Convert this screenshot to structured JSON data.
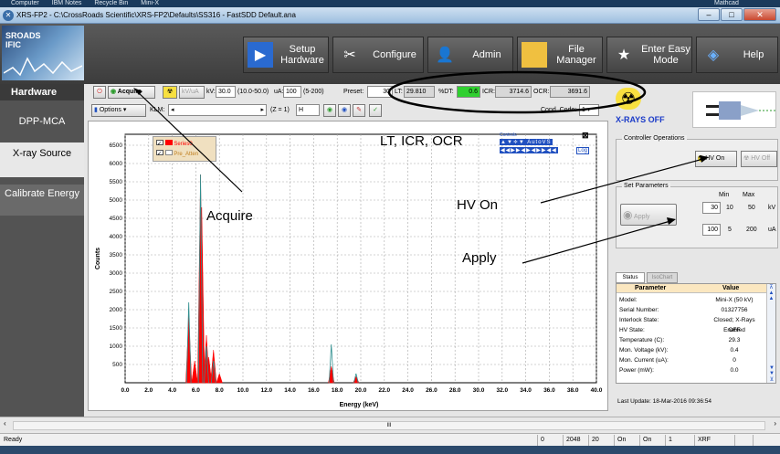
{
  "desktop": {
    "items": [
      "Computer",
      "IBM Notes",
      "Recycle Bin",
      "Mini-X",
      "Mathcad"
    ]
  },
  "window": {
    "title": "XRS-FP2 - C:\\CrossRoads Scientific\\XRS-FP2\\Defaults\\SS316 - FastSDD Default.ana"
  },
  "toolbar": {
    "logo_line1": "SROADS",
    "logo_line2": "IFIC",
    "setup": "Setup Hardware",
    "configure": "Configure",
    "admin": "Admin",
    "file": "File Manager",
    "easy": "Enter Easy Mode",
    "help": "Help"
  },
  "nav": {
    "hardware": "Hardware",
    "dpp": "DPP-MCA",
    "xray": "X-ray Source",
    "calibrate": "Calibrate Energy"
  },
  "controls": {
    "acquire": "Acquire",
    "kv_ua": "kV/uA",
    "kv_label": "kV:",
    "kv_value": "30.0",
    "kv_range": "(10.0-50.0)",
    "ua_label": "uA:",
    "ua_value": "100",
    "ua_range": "(5-200)",
    "preset_label": "Preset:",
    "preset_value": "30",
    "lt_label": "LT:",
    "lt_value": "29.810",
    "dt_label": "%DT:",
    "dt_value": "0.6",
    "icr_label": "ICR:",
    "icr_value": "3714.6",
    "ocr_label": "OCR:",
    "ocr_value": "3691.6",
    "options": "Options",
    "klm_label": "KLM:",
    "z_label": "(Z = 1)",
    "z_value": "H",
    "cond_label": "Cond. Code:",
    "cond_value": "1"
  },
  "legend": {
    "series0": "Series0",
    "preatten": "Pre_Atten"
  },
  "ctrl_panel": {
    "title": "Controls",
    "autovs": "AutoVS",
    "log": "Log"
  },
  "chart_data": {
    "type": "line",
    "xlabel": "Energy (keV)",
    "ylabel": "Counts",
    "xlim": [
      0,
      40
    ],
    "ylim": [
      0,
      6800
    ],
    "xticks": [
      "0.0",
      "2.0",
      "4.0",
      "6.0",
      "8.0",
      "10.0",
      "12.0",
      "14.0",
      "16.0",
      "18.0",
      "20.0",
      "22.0",
      "24.0",
      "26.0",
      "28.0",
      "30.0",
      "32.0",
      "34.0",
      "36.0",
      "38.0",
      "40.0"
    ],
    "yticks": [
      "500",
      "1000",
      "1500",
      "2000",
      "2500",
      "3000",
      "3500",
      "4000",
      "4500",
      "5000",
      "5500",
      "6000",
      "6500"
    ],
    "grid": true,
    "legend": "top-left",
    "series": [
      {
        "name": "Series0",
        "color": "#ff0000",
        "x": [
          5.4,
          5.9,
          6.4,
          6.5,
          6.9,
          7.1,
          7.5,
          8.0,
          17.5,
          19.6
        ],
        "y": [
          1850,
          600,
          5700,
          4800,
          1300,
          700,
          900,
          250,
          450,
          170
        ]
      },
      {
        "name": "Pre_Atten",
        "color": "#2f8f8f",
        "x": [
          5.4,
          6.4,
          6.9,
          7.5,
          17.5,
          19.6
        ],
        "y": [
          2200,
          5700,
          1000,
          600,
          1050,
          250
        ]
      }
    ]
  },
  "right": {
    "xray_status": "X-RAYS OFF",
    "ctrl_ops": "Controller Operations",
    "hv_on": "HV On",
    "hv_off": "HV Off",
    "set_params": "Set Parameters",
    "min": "Min",
    "max": "Max",
    "kv_set": "30",
    "kv_min": "10",
    "kv_max": "50",
    "kv_unit": "kV",
    "ua_set": "100",
    "ua_min": "5",
    "ua_max": "200",
    "ua_unit": "uA",
    "apply": "Apply",
    "tab_status": "Status",
    "tab_iso": "IsoChart",
    "col_param": "Parameter",
    "col_value": "Value",
    "rows": [
      {
        "p": "Model:",
        "v": "Mini-X (50 kV)"
      },
      {
        "p": "Serial Number:",
        "v": "01327756"
      },
      {
        "p": "Interlock State:",
        "v": "Closed; X-Rays Enabled"
      },
      {
        "p": "HV State:",
        "v": "OFF"
      },
      {
        "p": "Temperature (C):",
        "v": "29.3"
      },
      {
        "p": "Mon. Voltage (kV):",
        "v": "0.4"
      },
      {
        "p": "Mon. Current (uA):",
        "v": "0"
      },
      {
        "p": "Power (mW):",
        "v": "0.0"
      }
    ],
    "last_update": "Last Update:  18-Mar-2016 09:36:54"
  },
  "statusbar": {
    "ready": "Ready",
    "c1": "0",
    "c2": "2048",
    "c3": "20",
    "c4": "On",
    "c5": "On",
    "c6": "1",
    "c7": "XRF"
  },
  "scroll": {
    "mark": "III"
  },
  "annotations": {
    "lt": "LT, ICR, OCR",
    "acquire": "Acquire",
    "hvon": "HV On",
    "apply": "Apply"
  }
}
